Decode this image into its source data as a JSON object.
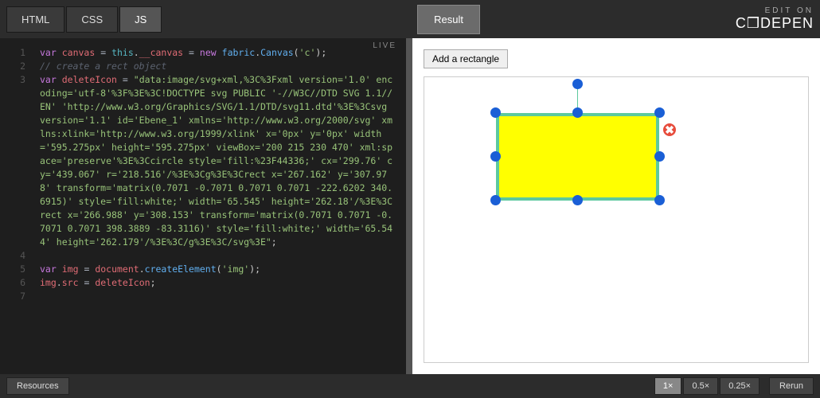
{
  "header": {
    "tabs": {
      "html": "HTML",
      "css": "CSS",
      "js": "JS"
    },
    "result_tab": "Result",
    "edit_on": "EDIT ON",
    "logo": "C❒DEPEN"
  },
  "editor": {
    "live_badge": "LIVE",
    "lines": [
      {
        "n": "1",
        "html": "<span class='kw'>var</span> <span class='var'>canvas</span> <span class='op'>=</span> <span class='this'>this</span>.<span class='var'>__canvas</span> <span class='op'>=</span> <span class='kw'>new</span> <span class='fn'>fabric</span>.<span class='fn'>Canvas</span>(<span class='str'>'c'</span>);"
      },
      {
        "n": "2",
        "html": "<span class='cmt'>// create a rect object</span>"
      },
      {
        "n": "3",
        "html": "<span class='kw'>var</span> <span class='var'>deleteIcon</span> <span class='op'>=</span> <span class='str'>\"data:image/svg+xml,%3C%3Fxml version='1.0' encoding='utf-8'%3F%3E%3C!DOCTYPE svg PUBLIC '-//W3C//DTD SVG 1.1//EN' 'http://www.w3.org/Graphics/SVG/1.1/DTD/svg11.dtd'%3E%3Csvg version='1.1' id='Ebene_1' xmlns='http://www.w3.org/2000/svg' xmlns:xlink='http://www.w3.org/1999/xlink' x='0px' y='0px' width='595.275px' height='595.275px' viewBox='200 215 230 470' xml:space='preserve'%3E%3Ccircle style='fill:%23F44336;' cx='299.76' cy='439.067' r='218.516'/%3E%3Cg%3E%3Crect x='267.162' y='307.978' transform='matrix(0.7071 -0.7071 0.7071 0.7071 -222.6202 340.6915)' style='fill:white;' width='65.545' height='262.18'/%3E%3Crect x='266.988' y='308.153' transform='matrix(0.7071 0.7071 -0.7071 0.7071 398.3889 -83.3116)' style='fill:white;' width='65.544' height='262.179'/%3E%3C/g%3E%3C/svg%3E\"</span>;"
      },
      {
        "n": "4",
        "html": ""
      },
      {
        "n": "5",
        "html": "<span class='kw'>var</span> <span class='var'>img</span> <span class='op'>=</span> <span class='var'>document</span>.<span class='fn'>createElement</span>(<span class='str'>'img'</span>);"
      },
      {
        "n": "6",
        "html": "<span class='var'>img</span>.<span class='var'>src</span> <span class='op'>=</span> <span class='var'>deleteIcon</span>;"
      },
      {
        "n": "7",
        "html": ""
      }
    ]
  },
  "result": {
    "add_button": "Add a rectangle",
    "delete_glyph": "✖"
  },
  "footer": {
    "resources": "Resources",
    "zoom": [
      "1×",
      "0.5×",
      "0.25×"
    ],
    "rerun": "Rerun"
  }
}
